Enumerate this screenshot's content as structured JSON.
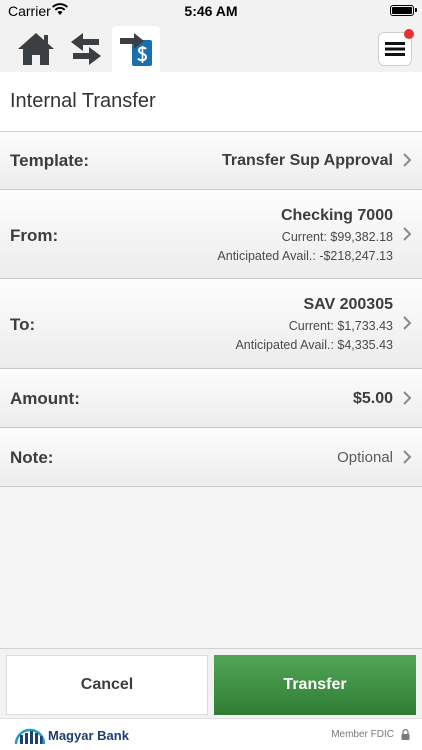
{
  "status_bar": {
    "carrier": "Carrier",
    "time": "5:46 AM"
  },
  "nav": {
    "icons": [
      "home-icon",
      "transfer-arrows-icon",
      "internal-transfer-icon",
      "hamburger-menu-icon"
    ],
    "accent_color": "#1a6fb0",
    "badge_color": "#e8312f"
  },
  "page": {
    "title": "Internal Transfer"
  },
  "form": {
    "template": {
      "label": "Template:",
      "value": "Transfer Sup Approval"
    },
    "from": {
      "label": "From:",
      "account": "Checking 7000",
      "current": "Current:  $99,382.18",
      "anticipated": "Anticipated Avail.:  -$218,247.13"
    },
    "to": {
      "label": "To:",
      "account": "SAV 200305",
      "current": "Current:  $1,733.43",
      "anticipated": "Anticipated Avail.:  $4,335.43"
    },
    "amount": {
      "label": "Amount:",
      "value": "$5.00"
    },
    "note": {
      "label": "Note:",
      "placeholder": "Optional"
    }
  },
  "actions": {
    "cancel_label": "Cancel",
    "transfer_label": "Transfer",
    "transfer_color": "#3f9044"
  },
  "footer": {
    "bank_name": "Magyar Bank",
    "fdic_text": "Member FDIC"
  }
}
